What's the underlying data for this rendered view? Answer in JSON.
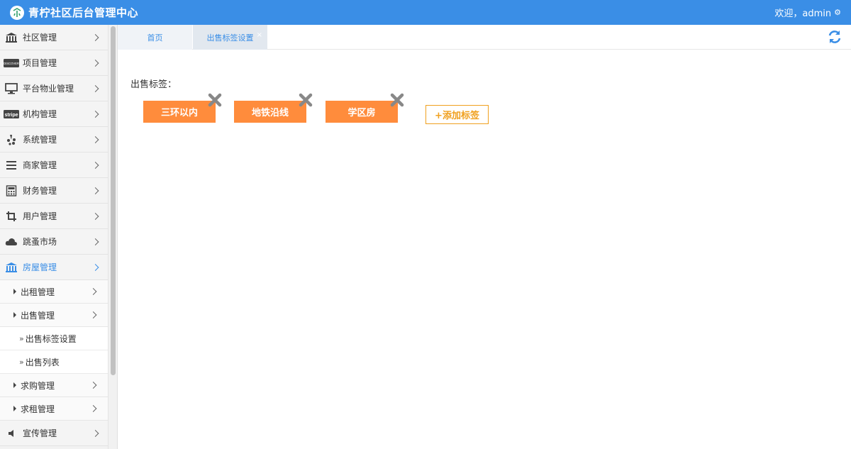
{
  "header": {
    "title": "青柠社区后台管理中心",
    "welcome": "欢迎，admin",
    "gear_icon": "gear-icon",
    "brand_color": "#3a8ee6"
  },
  "sidebar": {
    "menu": [
      {
        "label": "社区管理",
        "icon": "bank-icon"
      },
      {
        "label": "项目管理",
        "icon": "discover-card-icon",
        "icon_text": "DISCOVER"
      },
      {
        "label": "平台物业管理",
        "icon": "monitor-icon"
      },
      {
        "label": "机构管理",
        "icon": "stripe-icon",
        "icon_text": "stripe"
      },
      {
        "label": "系统管理",
        "icon": "yelp-icon"
      },
      {
        "label": "商家管理",
        "icon": "bars-icon"
      },
      {
        "label": "财务管理",
        "icon": "calculator-icon"
      },
      {
        "label": "用户管理",
        "icon": "crop-icon"
      },
      {
        "label": "跳蚤市场",
        "icon": "cloud-icon"
      },
      {
        "label": "房屋管理",
        "icon": "bank-icon",
        "active": true
      }
    ],
    "house_sub": [
      {
        "label": "出租管理"
      },
      {
        "label": "出售管理"
      }
    ],
    "sale_leaves": [
      {
        "label": "出售标签设置"
      },
      {
        "label": "出售列表"
      }
    ],
    "house_sub2": [
      {
        "label": "求购管理"
      },
      {
        "label": "求租管理"
      }
    ],
    "bottom_menu": {
      "label": "宣传管理",
      "icon": "volume-icon"
    },
    "raquo": "»"
  },
  "tabs": {
    "home": "首页",
    "current": "出售标签设置",
    "close": "×"
  },
  "content": {
    "label": "出售标签：",
    "tags": [
      "三环以内",
      "地铁沿线",
      "学区房"
    ],
    "add_button": "+添加标签",
    "tag_color": "#ff8c3c",
    "add_color": "#f0a01e"
  }
}
